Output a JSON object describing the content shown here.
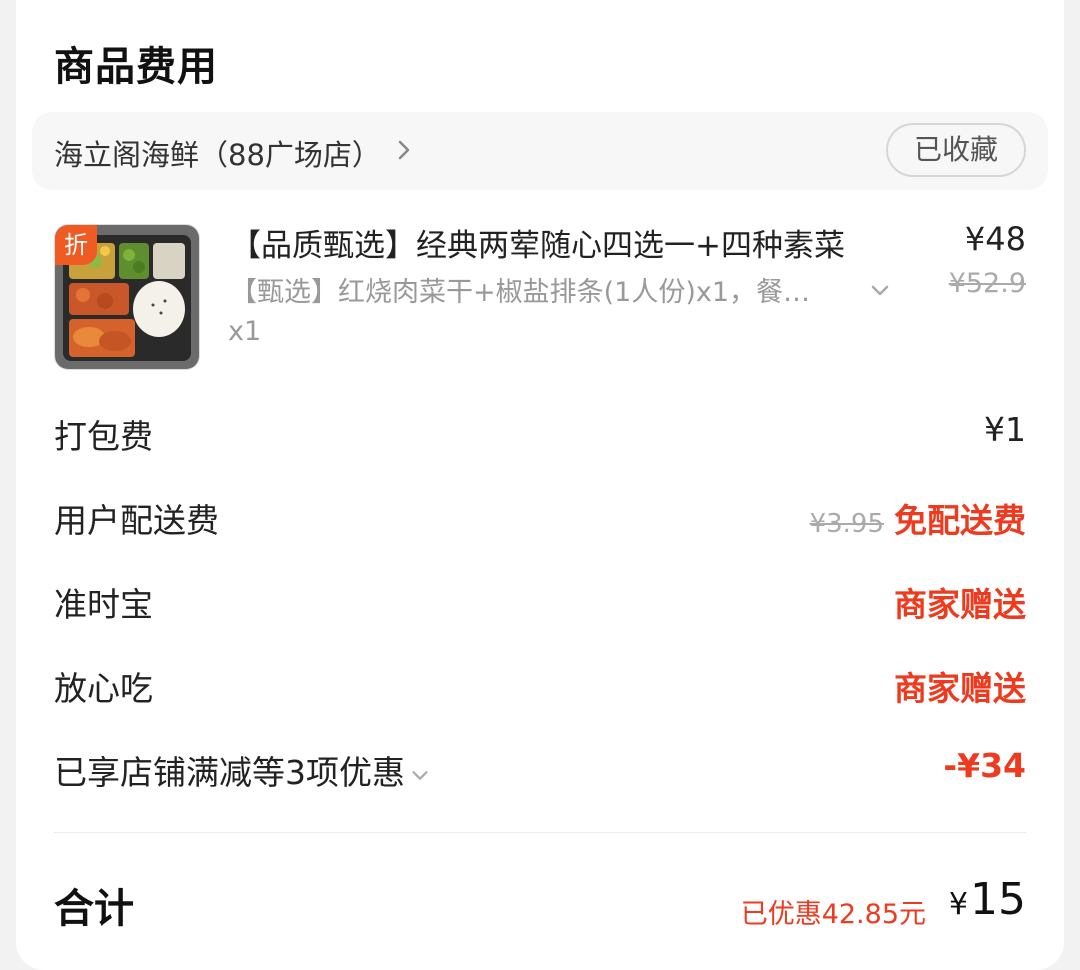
{
  "header": {
    "title": "商品费用"
  },
  "store": {
    "name": "海立阁海鲜（88广场店）",
    "favorite_label": "已收藏"
  },
  "item": {
    "discount_tag": "折",
    "name": "【品质甄选】经典两荤随心四选一+四种素菜",
    "detail": "【甄选】红烧肉菜干+椒盐排条(1人份)x1，餐…",
    "quantity": "x1",
    "price": "¥48",
    "original_price": "¥52.9"
  },
  "fees": {
    "packing": {
      "label": "打包费",
      "value": "¥1"
    },
    "delivery": {
      "label": "用户配送费",
      "original": "¥3.95",
      "value": "免配送费"
    },
    "ontime": {
      "label": "准时宝",
      "value": "商家赠送"
    },
    "safe_eat": {
      "label": "放心吃",
      "value": "商家赠送"
    },
    "discounts": {
      "label": "已享店铺满减等3项优惠",
      "value": "-¥34"
    }
  },
  "total": {
    "label": "合计",
    "saved": "已优惠42.85元",
    "currency": "¥",
    "amount": "15"
  },
  "colors": {
    "accent_red": "#ee3b1f",
    "tag_orange": "#f05a23"
  },
  "icons": {
    "store_chevron": "chevron-right-icon",
    "detail_chevron": "chevron-down-icon",
    "discount_chevron": "chevron-down-icon"
  }
}
